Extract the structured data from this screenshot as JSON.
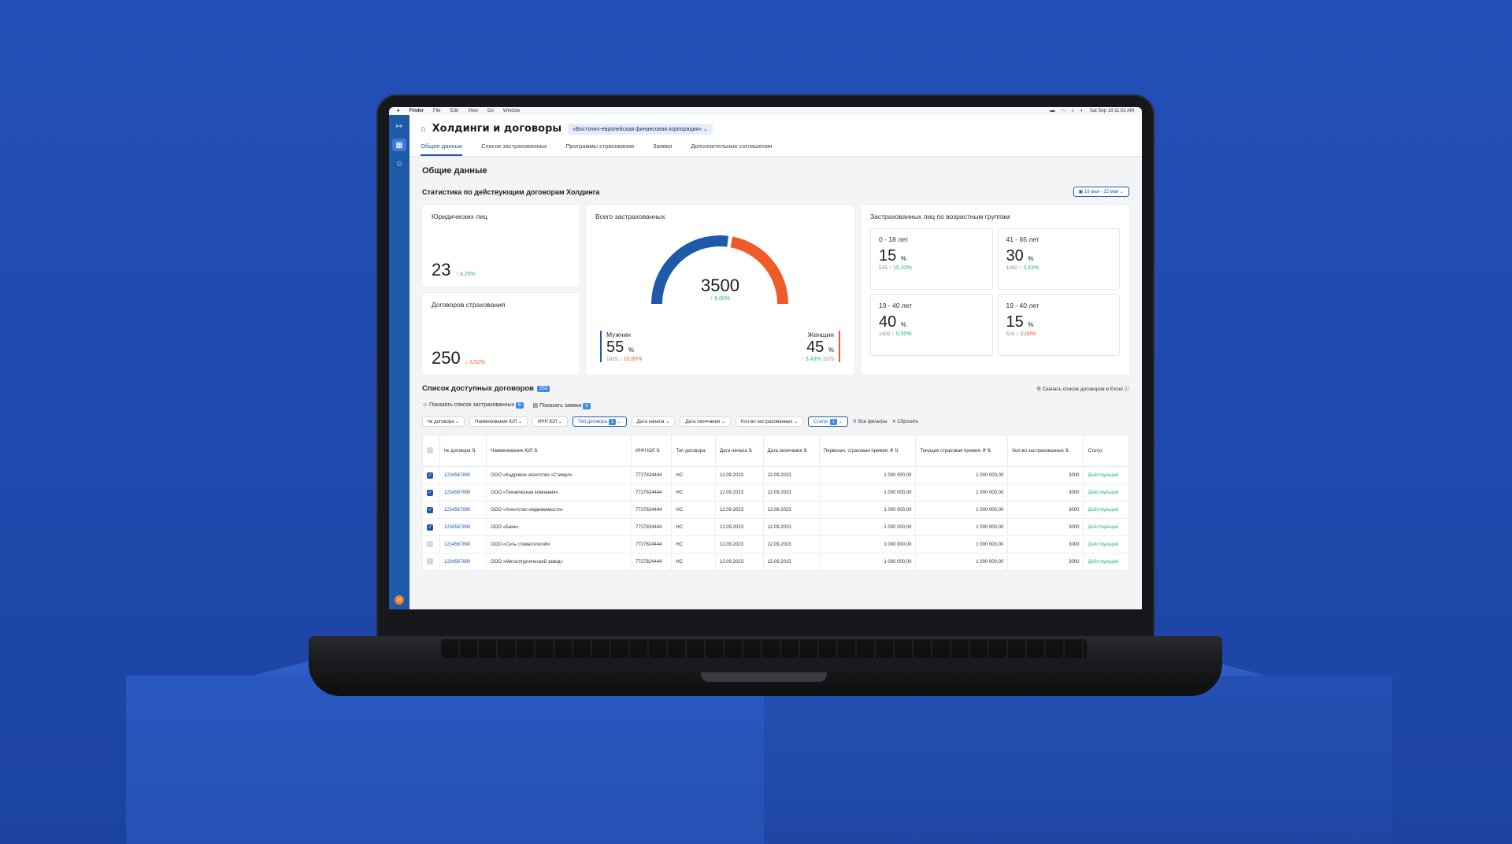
{
  "menubar": {
    "apple": "",
    "items": [
      "Finder",
      "File",
      "Edit",
      "View",
      "Go",
      "Window"
    ],
    "clock": "Sat Sep 18  11:02 AM"
  },
  "header": {
    "title": "Холдинги и договоры",
    "holding": "«Восточно-европейская финансовая корпорация»"
  },
  "tabs": [
    "Общие данные",
    "Список застрахованных",
    "Программы страхования",
    "Заявки",
    "Дополнительные соглашения"
  ],
  "section_title": "Общие данные",
  "stats_title": "Статистика по действующим договорам Холдинга",
  "date_range": "16 мая - 22 мая",
  "legal": {
    "label": "Юридических лиц",
    "value": "23",
    "delta": "↑ 4,25%"
  },
  "contracts": {
    "label": "Договоров страхования",
    "value": "250",
    "delta": "↓ 3,52%"
  },
  "insured": {
    "label": "Всего застрахованных",
    "total": "3500",
    "delta": "↑ 6,00%",
    "men_share": 0.55,
    "women_share": 0.45,
    "men": {
      "label": "Мужчин",
      "pct": "55",
      "unit": "%",
      "count": "1925",
      "delta": "↓ 10,00%"
    },
    "women": {
      "label": "Женщин",
      "pct": "45",
      "unit": "%",
      "count": "1575",
      "delta": "↑ 3,43%"
    }
  },
  "ages": {
    "title": "Застрахованных лиц по возрастным группам",
    "groups": [
      {
        "label": "0 - 18 лет",
        "pct": "15",
        "unit": "%",
        "count": "525",
        "delta": "↑ 15,33%",
        "dir": "up"
      },
      {
        "label": "41 - 65 лет",
        "pct": "30",
        "unit": "%",
        "count": "1050",
        "delta": "↑ 3,43%",
        "dir": "up"
      },
      {
        "label": "19 - 40 лет",
        "pct": "40",
        "unit": "%",
        "count": "1400",
        "delta": "↑ 0,50%",
        "dir": "up"
      },
      {
        "label": "19 - 40 лет",
        "pct": "15",
        "unit": "%",
        "count": "525",
        "delta": "↓ 2,00%",
        "dir": "down"
      }
    ]
  },
  "list": {
    "title": "Список доступных договоров",
    "count": "250",
    "excel": "Скачать список  договоров в Excel",
    "show_insured": "Показать список застрахованных",
    "show_insured_badge": "6",
    "show_requests": "Показать заявки",
    "show_requests_badge": "6",
    "filters": [
      "№ договора",
      "Наименование ЮЛ",
      "ИНН ЮЛ",
      "Тип договора",
      "Дата начала",
      "Дата окончания",
      "Кол-во застрахованных",
      "Статус"
    ],
    "filter_on_badge": "1",
    "all_filters": "Все фильтры",
    "reset": "Сбросить",
    "columns": [
      "№ договора",
      "Наименование ЮЛ",
      "ИНН ЮЛ",
      "Тип договора",
      "Дата начала",
      "Дата окончания",
      "Первонач. страховая премия, ₽",
      "Текущая страховая премия, ₽",
      "Кол-во застрахованных",
      "Статус"
    ],
    "rows": [
      {
        "checked": true,
        "no": "1234567890",
        "name": "ООО «Кадровое агентство «Стимул»",
        "inn": "7727824444",
        "type": "НС",
        "start": "12.09.2023",
        "end": "12.09.2023",
        "p1": "1 000 000,00",
        "p2": "1 000 000,00",
        "qty": "3000",
        "status": "Действующий"
      },
      {
        "checked": true,
        "no": "1234567890",
        "name": "ООО «Техническая компания»",
        "inn": "7727824444",
        "type": "НС",
        "start": "12.09.2023",
        "end": "12.09.2023",
        "p1": "1 000 000,00",
        "p2": "1 000 000,00",
        "qty": "3000",
        "status": "Действующий"
      },
      {
        "checked": true,
        "no": "1234567890",
        "name": "ООО «Агентство недвижимости»",
        "inn": "7727824444",
        "type": "НС",
        "start": "12.09.2023",
        "end": "12.09.2023",
        "p1": "1 000 000,00",
        "p2": "1 000 000,00",
        "qty": "3000",
        "status": "Действующий"
      },
      {
        "checked": true,
        "no": "1234567890",
        "name": "ООО «Банк»",
        "inn": "7727824444",
        "type": "НС",
        "start": "12.09.2023",
        "end": "12.09.2023",
        "p1": "1 000 000,00",
        "p2": "1 000 000,00",
        "qty": "3000",
        "status": "Действующий"
      },
      {
        "checked": false,
        "no": "1234567890",
        "name": "ООО «Сеть стоматологий»",
        "inn": "7727824444",
        "type": "НС",
        "start": "12.09.2023",
        "end": "12.09.2023",
        "p1": "1 000 000,00",
        "p2": "1 000 000,00",
        "qty": "3000",
        "status": "Действующий"
      },
      {
        "checked": false,
        "no": "1234567890",
        "name": "ООО «Металлургический завод»",
        "inn": "7727824444",
        "type": "НС",
        "start": "12.09.2023",
        "end": "12.09.2023",
        "p1": "1 000 000,00",
        "p2": "1 000 000,00",
        "qty": "3000",
        "status": "Действующий"
      }
    ]
  },
  "user_initial": "И",
  "colors": {
    "blue": "#1f5aa8",
    "orange": "#f05a28",
    "green": "#2bb673",
    "bg": "#2350b8"
  }
}
